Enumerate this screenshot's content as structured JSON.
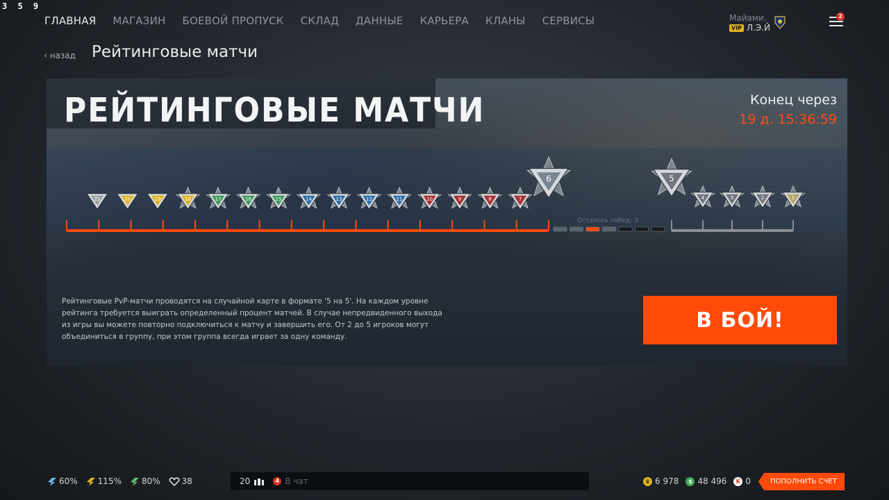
{
  "fps": "3 5 9",
  "nav": {
    "items": [
      "ГЛАВНАЯ",
      "МАГАЗИН",
      "БОЕВОЙ ПРОПУСК",
      "СКЛАД",
      "ДАННЫЕ",
      "КАРЬЕРА",
      "КЛАНЫ",
      "СЕРВИСЫ"
    ],
    "active": "ГЛАВНАЯ"
  },
  "user": {
    "city": "Майами.",
    "vip": "VIP",
    "nick": "Л.Э.Й"
  },
  "menu_badge": "2",
  "back_label": "назад",
  "page_title": "Рейтинговые матчи",
  "banner": {
    "title": "РЕЙТИНГОВЫЕ МАТЧИ",
    "ends_label": "Конец через",
    "ends_time": "19 д. 15:36:59",
    "wins_left": "Осталось побед: 3"
  },
  "ranks": {
    "current": "6",
    "main_track": [
      "21",
      "20",
      "19",
      "18",
      "17",
      "16",
      "15",
      "14",
      "13",
      "12",
      "11",
      "10",
      "9",
      "8",
      "7"
    ],
    "future": [
      "5",
      "4",
      "3",
      "2",
      "1"
    ],
    "progress_pips": 7,
    "progress_active_index": 2,
    "colors": {
      "accent": "#ff4a0a",
      "ends": "#ff4e12"
    }
  },
  "description": "Рейтинговые PvP-матчи проводятся на случайной карте в формате '5 на 5'. На каждом уровне рейтинга требуется выиграть определенный процент матчей. В случае непредвиденного выхода из игры вы можете повторно подключиться к матчу и завершить его. От 2 до 5 игроков могут объединиться в группу, при этом группа всегда играет за одну команду.",
  "fight_button": "В БОЙ!",
  "boosts": [
    {
      "icon": "exp-boost-icon",
      "value": "60%",
      "color": "#6fb6e8"
    },
    {
      "icon": "money-boost-icon",
      "value": "115%",
      "color": "#e0b21e"
    },
    {
      "icon": "vip-boost-icon",
      "value": "80%",
      "color": "#57c46a"
    },
    {
      "icon": "heart-icon",
      "value": "38",
      "color": "#e8ecef"
    }
  ],
  "chat": {
    "online": "20",
    "notifications": "4",
    "placeholder": "В чат"
  },
  "wallet": {
    "crowns": "6 978",
    "warbucks": "48 496",
    "kredits": "0"
  },
  "topup_label": "ПОПОЛНИТЬ СЧЕТ"
}
